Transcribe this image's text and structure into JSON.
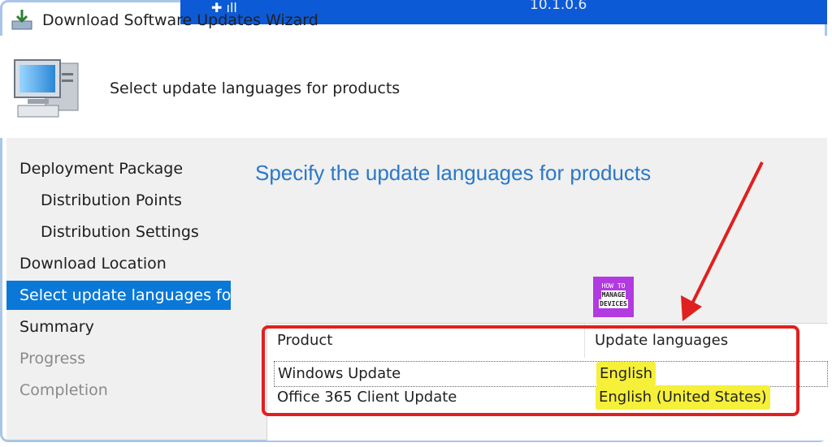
{
  "window": {
    "title": "Download Software Updates Wizard",
    "version": "10.1.0.6"
  },
  "header": {
    "heading": "Select update languages for products"
  },
  "nav": {
    "items": [
      {
        "label": "Deployment Package"
      },
      {
        "label": "Distribution Points"
      },
      {
        "label": "Distribution Settings"
      },
      {
        "label": "Download Location"
      },
      {
        "label": "Select update languages for"
      },
      {
        "label": "Summary"
      },
      {
        "label": "Progress"
      },
      {
        "label": "Completion"
      }
    ]
  },
  "content": {
    "title": "Specify the update languages for products",
    "table": {
      "columns": [
        "Product",
        "Update languages"
      ],
      "rows": [
        {
          "product": "Windows Update",
          "languages": "English"
        },
        {
          "product": "Office 365 Client Update",
          "languages": "English (United States)"
        }
      ]
    }
  },
  "logo": {
    "line1": "HOW TO",
    "line2": "MANAGE",
    "line3": "DEVICES"
  },
  "colors": {
    "accent": "#0a78d7",
    "title_blue": "#2a78c8",
    "annotation_red": "#e0201e",
    "highlight_yellow": "#f6f03a"
  }
}
